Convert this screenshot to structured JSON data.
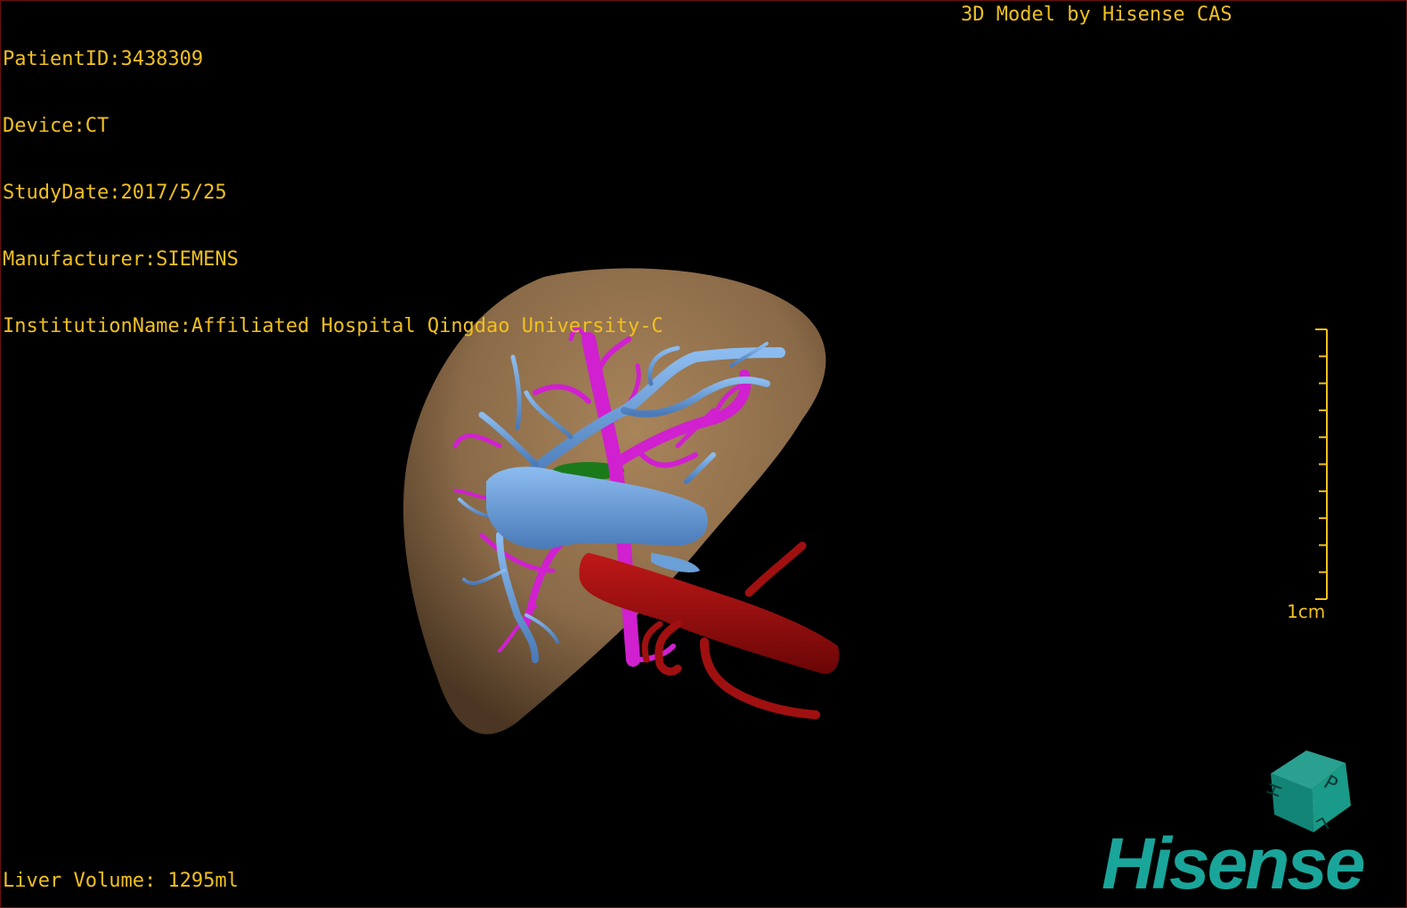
{
  "patient_info": {
    "patient_id": "PatientID:3438309",
    "device": "Device:CT",
    "study_date": "StudyDate:2017/5/25",
    "manufacturer": "Manufacturer:SIEMENS",
    "institution": "InstitutionName:Affiliated Hospital Qingdao University-C"
  },
  "credit": "3D Model by Hisense CAS",
  "liver_volume": "Liver Volume: 1295ml",
  "scale_bar": {
    "label": "1cm",
    "tick_count": 11
  },
  "orientation_cube": {
    "face_labels": [
      "P",
      "H",
      "L"
    ]
  },
  "brand_logo": "Hisense",
  "colors": {
    "overlay_text": "#f0c020",
    "liver": "#8a6a48",
    "portal_vein": "#6a9fd8",
    "hepatic_vein": "#d020d0",
    "artery": "#a01010",
    "gallbladder": "#1a7a1a",
    "brand": "#1aa59a"
  }
}
